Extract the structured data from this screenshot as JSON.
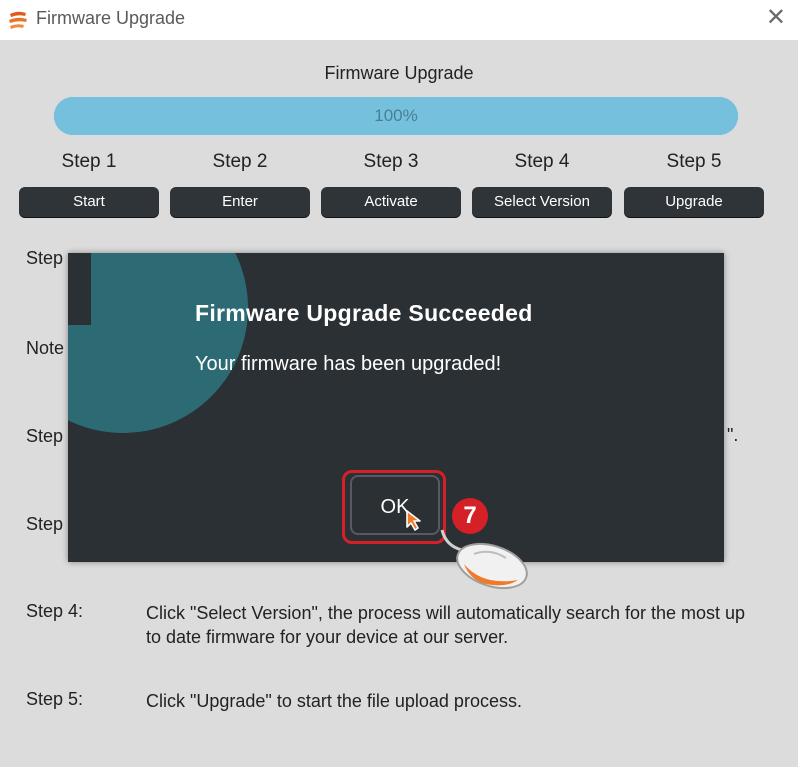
{
  "window": {
    "title": "Firmware Upgrade",
    "close_glyph": "✕"
  },
  "heading": "Firmware Upgrade",
  "progress": {
    "label": "100%",
    "fraction": 1.0
  },
  "steps": [
    {
      "label": "Step 1",
      "button": "Start"
    },
    {
      "label": "Step 2",
      "button": "Enter"
    },
    {
      "label": "Step 3",
      "button": "Activate"
    },
    {
      "label": "Step 4",
      "button": "Select Version"
    },
    {
      "label": "Step 5",
      "button": "Upgrade"
    }
  ],
  "side_fragments": [
    "Step",
    "Note",
    "Step",
    "Step"
  ],
  "trailing_fragment": "\".",
  "instructions": {
    "step4": {
      "label": "Step 4:",
      "text": "Click \"Select Version\", the process will automatically search for the most up to date firmware for your device at our server."
    },
    "step5": {
      "label": "Step 5:",
      "text": "Click \"Upgrade\" to start the file upload process."
    }
  },
  "dialog": {
    "title": "Firmware Upgrade Succeeded",
    "message": "Your firmware has been upgraded!",
    "ok_label": "OK",
    "icon": "info-icon"
  },
  "annotation": {
    "step_number": "7"
  },
  "colors": {
    "progress": "#74c0dd",
    "dialog_bg": "#2b3034",
    "info_circle": "#2c6b73",
    "highlight": "#d62027",
    "button_bg": "#2f3439"
  }
}
